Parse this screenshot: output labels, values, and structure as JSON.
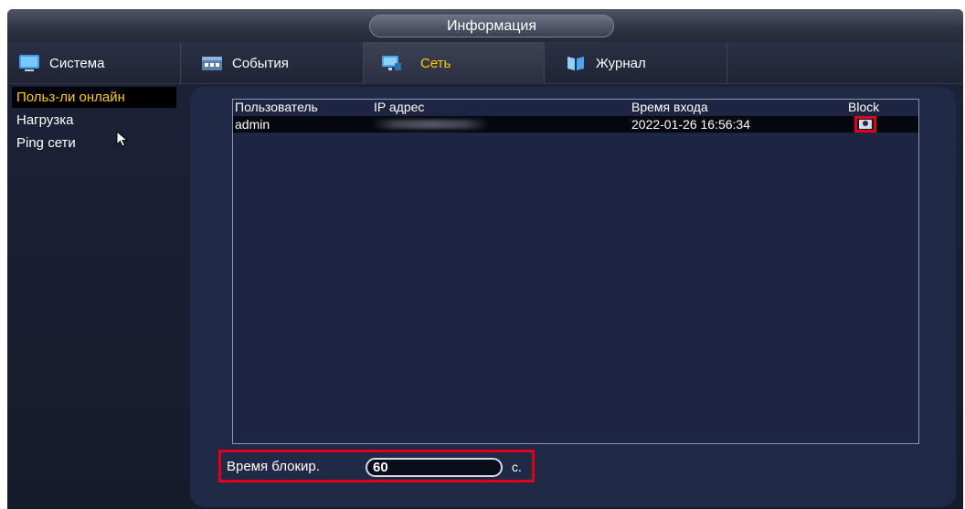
{
  "window": {
    "title": "Информация"
  },
  "tabs": [
    {
      "label": "Система",
      "icon": "monitor-icon",
      "active": false
    },
    {
      "label": "События",
      "icon": "events-icon",
      "active": false
    },
    {
      "label": "Сеть",
      "icon": "network-icon",
      "active": true
    },
    {
      "label": "Журнал",
      "icon": "log-book-icon",
      "active": false
    }
  ],
  "sidebar": {
    "items": [
      {
        "label": "Польз-ли онлайн",
        "active": true
      },
      {
        "label": "Нагрузка",
        "active": false
      },
      {
        "label": "Ping сети",
        "active": false
      }
    ]
  },
  "online_users": {
    "columns": [
      "Пользователь",
      "IP адрес",
      "Время входа",
      "Block"
    ],
    "rows": [
      {
        "user": "admin",
        "ip": "",
        "login_time": "2022-01-26 16:56:34",
        "block_icon": "block-user-icon"
      }
    ]
  },
  "block_time": {
    "label": "Время блокир.",
    "value": "60",
    "unit": "с."
  },
  "colors": {
    "accent": "#ffcc00",
    "highlight": "#e0001a",
    "panel": "#202945"
  }
}
